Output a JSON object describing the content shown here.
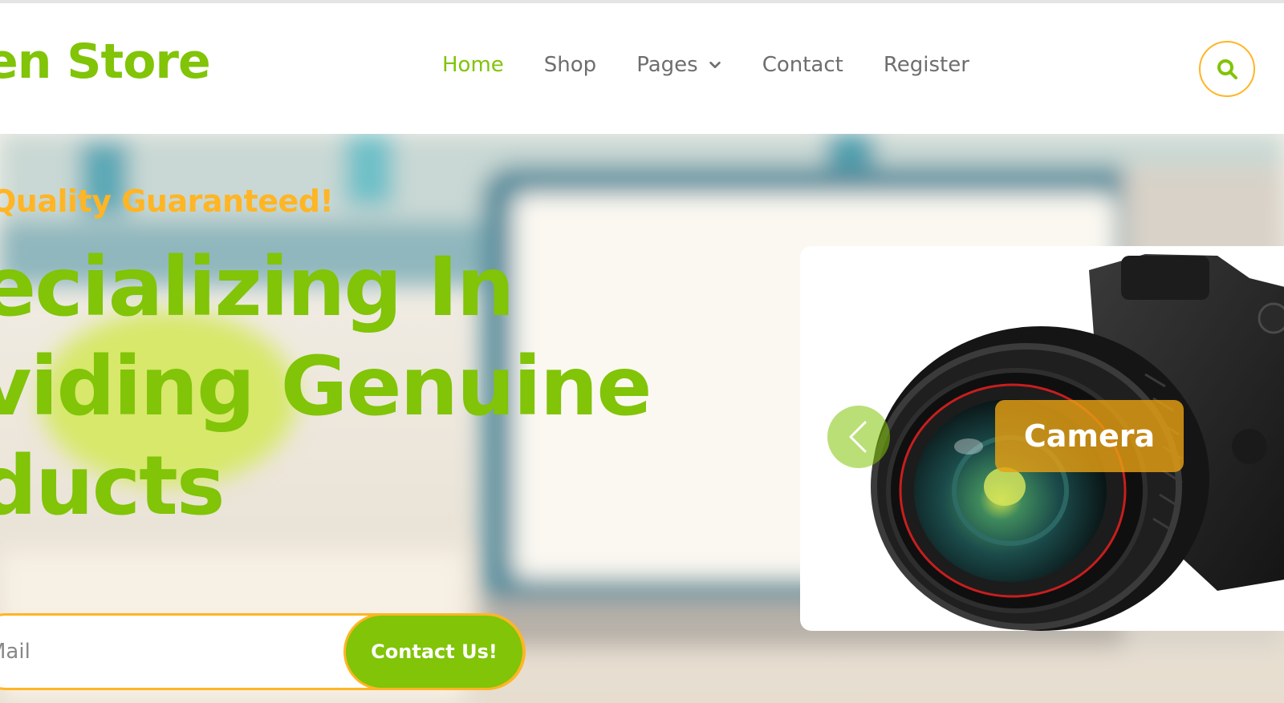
{
  "header": {
    "logo": "en Store",
    "nav": [
      {
        "label": "Home",
        "active": true
      },
      {
        "label": "Shop",
        "active": false
      },
      {
        "label": "Pages",
        "active": false
      },
      {
        "label": "Contact",
        "active": false
      },
      {
        "label": "Register",
        "active": false
      }
    ],
    "search_icon": "search-icon"
  },
  "hero": {
    "tagline": "Quality Guaranteed!",
    "headline_lines": [
      "pecializing In",
      "oviding Genuine",
      "oducts"
    ],
    "email_placeholder": "Mail",
    "contact_button": "Contact Us!"
  },
  "carousel": {
    "slide_label": "Camera",
    "prev_icon": "chevron-left-icon"
  },
  "colors": {
    "primary_green": "#81c408",
    "accent_orange": "#ffb524",
    "nav_gray": "#6e6e6e"
  }
}
